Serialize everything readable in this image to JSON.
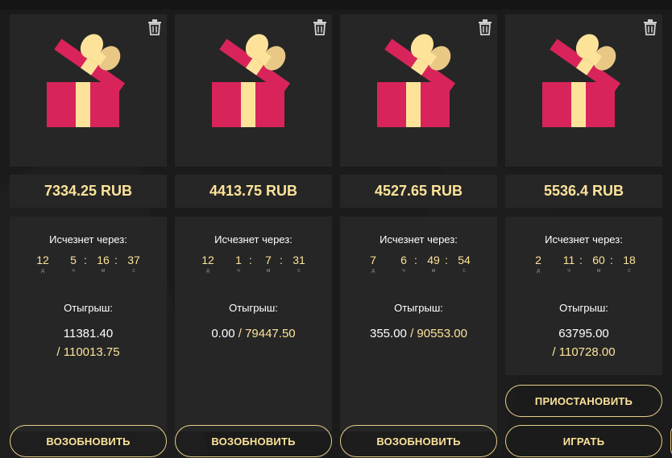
{
  "labels": {
    "expires_in": "Исчезнет через:",
    "winnings": "Отыгрыш:",
    "unit_days": "д",
    "unit_hours": "ч",
    "unit_minutes": "м",
    "unit_seconds": "с",
    "slash": "/"
  },
  "colors": {
    "accent": "#fde39a",
    "panel": "#262626",
    "background": "#1b1b1b",
    "gift_red": "#d8245a",
    "gift_ribbon": "#fde39a"
  },
  "icons": {
    "delete": "trash-icon",
    "gift": "gift-icon"
  },
  "cards": [
    {
      "price": "7334.25 RUB",
      "timer": {
        "d": "12",
        "h": "5",
        "m": "16",
        "s": "37"
      },
      "winnings_current": "11381.40",
      "winnings_target": "110013.75",
      "button": "ВОЗОБНОВИТЬ"
    },
    {
      "price": "4413.75 RUB",
      "timer": {
        "d": "12",
        "h": "1",
        "m": "7",
        "s": "31"
      },
      "winnings_current": "0.00",
      "winnings_target": "79447.50",
      "button": "ВОЗОБНОВИТЬ"
    },
    {
      "price": "4527.65 RUB",
      "timer": {
        "d": "7",
        "h": "6",
        "m": "49",
        "s": "54"
      },
      "winnings_current": "355.00",
      "winnings_target": "90553.00",
      "button": "ВОЗОБНОВИТЬ"
    },
    {
      "price": "5536.4 RUB",
      "timer": {
        "d": "2",
        "h": "11",
        "m": "60",
        "s": "18"
      },
      "winnings_current": "63795.00",
      "winnings_target": "110728.00",
      "pause_button": "ПРИОСТАНОВИТЬ",
      "button": "ИГРАТЬ"
    }
  ]
}
